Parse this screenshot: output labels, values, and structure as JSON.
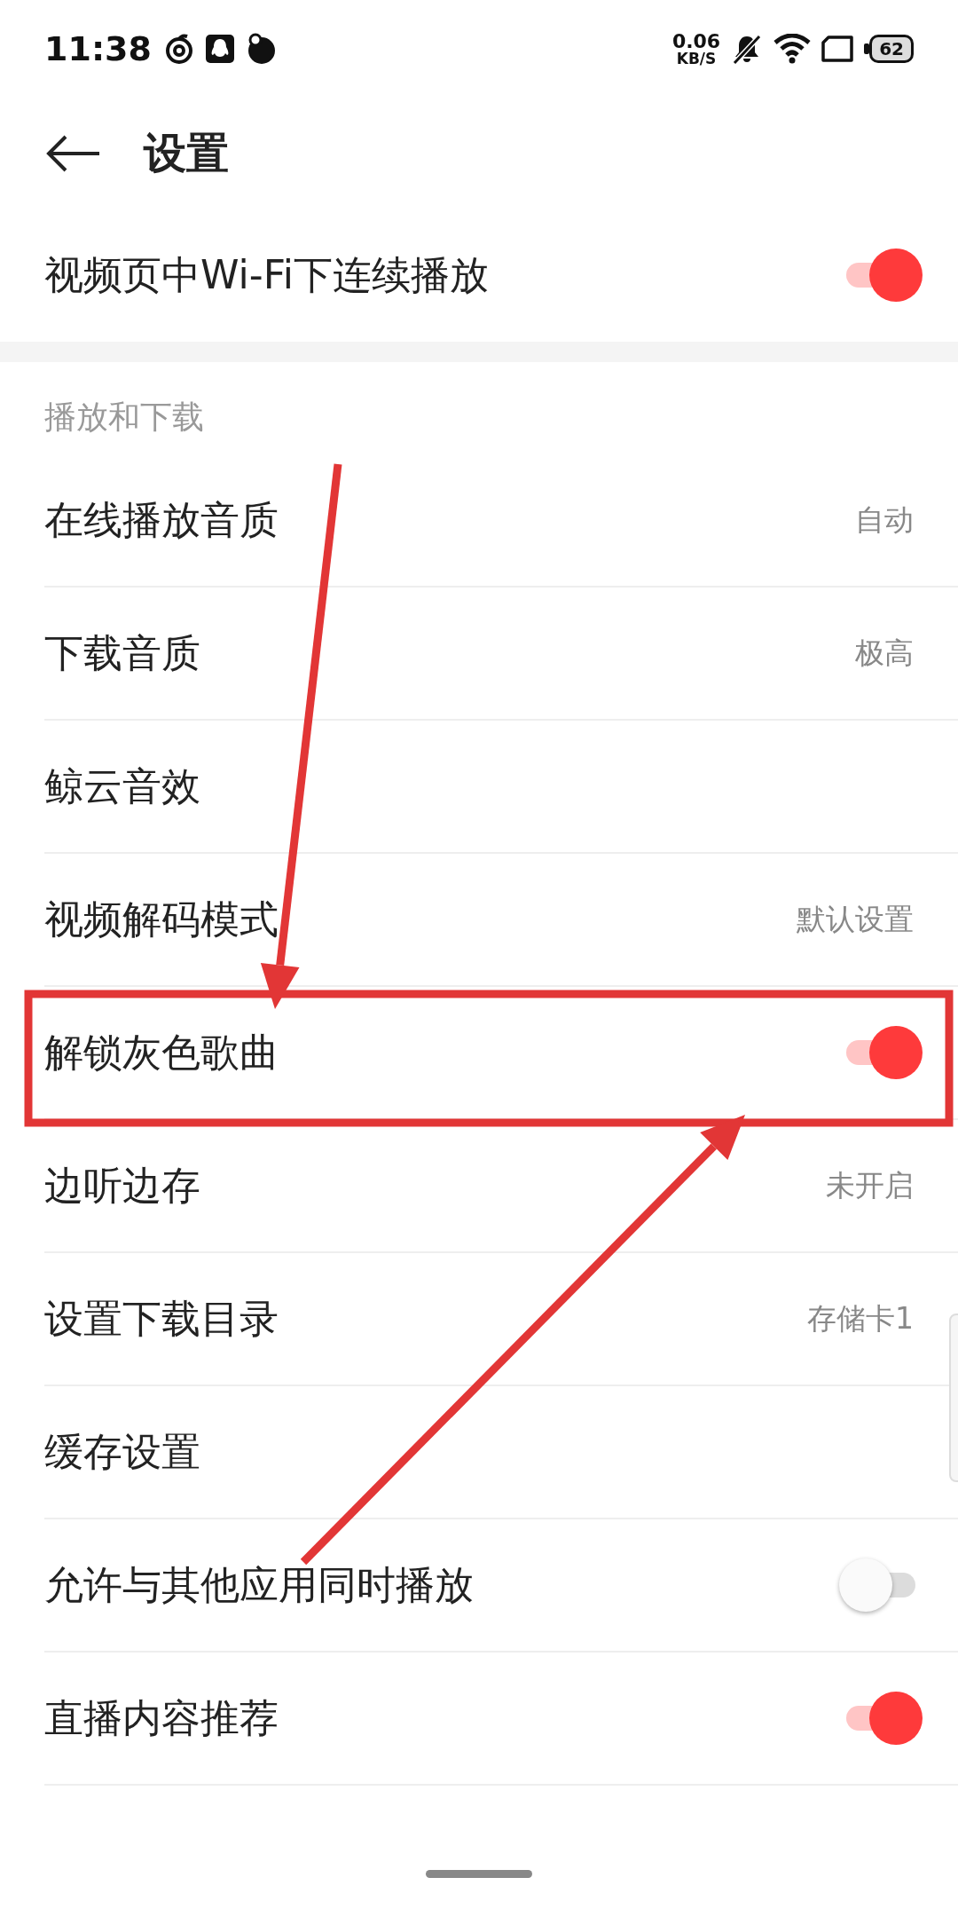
{
  "status_bar": {
    "time": "11:38",
    "net_speed": "0.06",
    "net_unit": "KB/S",
    "battery": "62"
  },
  "header": {
    "title": "设置"
  },
  "top_setting": {
    "label": "视频页中Wi-Fi下连续播放",
    "kind": "toggle",
    "on": true
  },
  "section": {
    "title": "播放和下载"
  },
  "rows": [
    {
      "label": "在线播放音质",
      "kind": "value",
      "value": "自动"
    },
    {
      "label": "下载音质",
      "kind": "value",
      "value": "极高"
    },
    {
      "label": "鲸云音效",
      "kind": "link"
    },
    {
      "label": "视频解码模式",
      "kind": "value",
      "value": "默认设置"
    },
    {
      "label": "解锁灰色歌曲",
      "kind": "toggle",
      "on": true
    },
    {
      "label": "边听边存",
      "kind": "value",
      "value": "未开启"
    },
    {
      "label": "设置下载目录",
      "kind": "value",
      "value": "存储卡1"
    },
    {
      "label": "缓存设置",
      "kind": "link"
    },
    {
      "label": "允许与其他应用同时播放",
      "kind": "toggle",
      "on": false
    },
    {
      "label": "直播内容推荐",
      "kind": "toggle",
      "on": true
    }
  ]
}
